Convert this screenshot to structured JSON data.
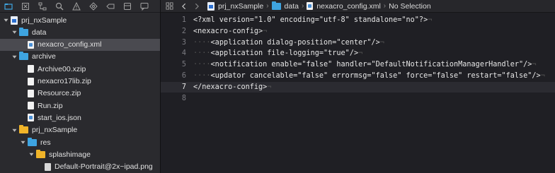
{
  "navigator": {
    "toolbar_icons": [
      "folder-icon",
      "close-square-icon",
      "hierarchy-icon",
      "search-icon",
      "warning-icon",
      "diamond-icon",
      "tag-icon",
      "layers-icon",
      "comment-icon"
    ],
    "tree": [
      {
        "label": "prj_nxSample",
        "icon": "project-file-icon",
        "depth": 0,
        "disclosure": "open",
        "selected": false
      },
      {
        "label": "data",
        "icon": "folder-blue-icon",
        "depth": 1,
        "disclosure": "open",
        "selected": false
      },
      {
        "label": "nexacro_config.xml",
        "icon": "xml-file-icon",
        "depth": 2,
        "disclosure": "none",
        "selected": true
      },
      {
        "label": "archive",
        "icon": "folder-blue-icon",
        "depth": 1,
        "disclosure": "open",
        "selected": false
      },
      {
        "label": "Archive00.xzip",
        "icon": "file-icon",
        "depth": 2,
        "disclosure": "none",
        "selected": false
      },
      {
        "label": "nexacro17lib.zip",
        "icon": "file-icon",
        "depth": 2,
        "disclosure": "none",
        "selected": false
      },
      {
        "label": "Resource.zip",
        "icon": "file-icon",
        "depth": 2,
        "disclosure": "none",
        "selected": false
      },
      {
        "label": "Run.zip",
        "icon": "file-icon",
        "depth": 2,
        "disclosure": "none",
        "selected": false
      },
      {
        "label": "start_ios.json",
        "icon": "json-file-icon",
        "depth": 2,
        "disclosure": "none",
        "selected": false
      },
      {
        "label": "prj_nxSample",
        "icon": "folder-yellow-icon",
        "depth": 1,
        "disclosure": "open",
        "selected": false
      },
      {
        "label": "res",
        "icon": "folder-blue-icon",
        "depth": 2,
        "disclosure": "open",
        "selected": false
      },
      {
        "label": "splashimage",
        "icon": "folder-yellow-icon",
        "depth": 3,
        "disclosure": "open",
        "selected": false
      },
      {
        "label": "Default-Portrait@2x~ipad.png",
        "icon": "image-file-icon",
        "depth": 4,
        "disclosure": "none",
        "selected": false
      }
    ]
  },
  "jumpbar": {
    "crumbs": [
      {
        "label": "prj_nxSample",
        "icon": "project-file-icon"
      },
      {
        "label": "data",
        "icon": "folder-blue-icon"
      },
      {
        "label": "nexacro_config.xml",
        "icon": "xml-file-icon"
      },
      {
        "label": "No Selection",
        "icon": ""
      }
    ]
  },
  "editor": {
    "current_line": 7,
    "lines": [
      {
        "n": "1",
        "indent": 0,
        "text": "<?xml version=\"1.0\" encoding=\"utf-8\" standalone=\"no\"?>"
      },
      {
        "n": "2",
        "indent": 0,
        "text": "<nexacro-config>"
      },
      {
        "n": "3",
        "indent": 1,
        "text": "<application dialog-position=\"center\"/>"
      },
      {
        "n": "4",
        "indent": 1,
        "text": "<application file-logging=\"true\"/>"
      },
      {
        "n": "5",
        "indent": 1,
        "text": "<notification enable=\"false\" handler=\"DefaultNotificationManagerHandler\"/>"
      },
      {
        "n": "6",
        "indent": 1,
        "text": "<updator cancelable=\"false\" errormsg=\"false\" force=\"false\" restart=\"false\"/>"
      },
      {
        "n": "7",
        "indent": 0,
        "text": "</nexacro-config>"
      },
      {
        "n": "8",
        "indent": 0,
        "text": ""
      }
    ]
  },
  "colors": {
    "folder_blue": "#3ea4e0",
    "folder_yellow": "#f0b429",
    "selection": "#4a4a50",
    "editor_bg": "#1f1f24",
    "navigator_bg": "#2a2a2e"
  }
}
